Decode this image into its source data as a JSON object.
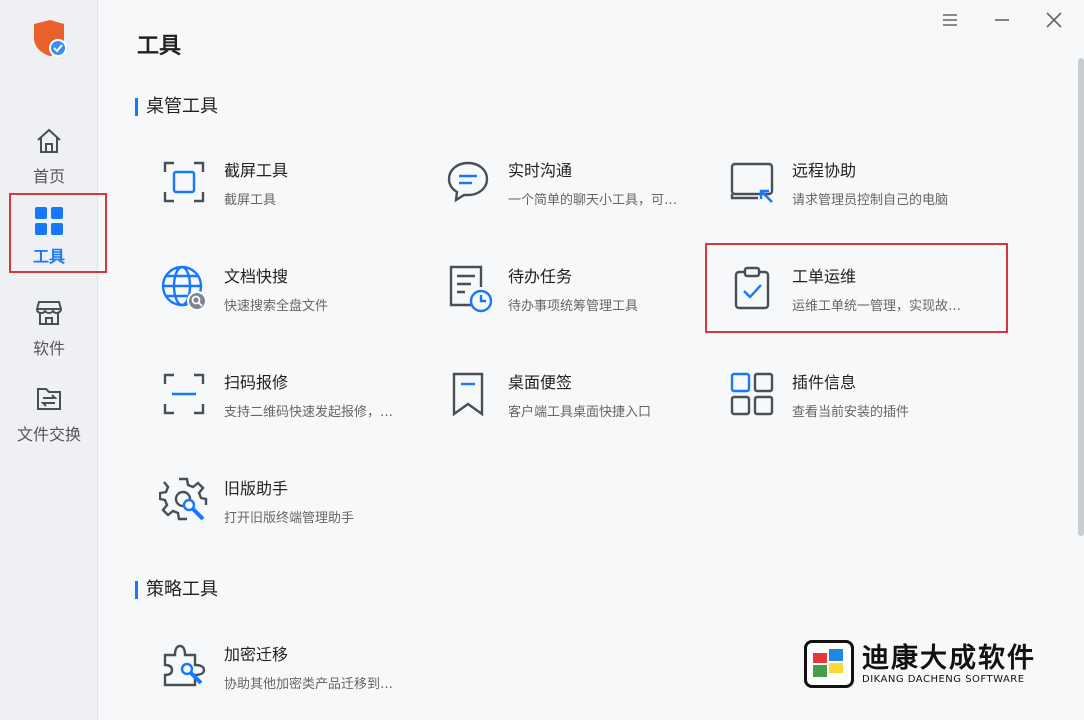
{
  "app": {
    "page_title": "工具"
  },
  "sidebar": {
    "items": [
      {
        "label": "首页",
        "icon": "home-icon"
      },
      {
        "label": "工具",
        "icon": "grid-icon",
        "active": true
      },
      {
        "label": "软件",
        "icon": "store-icon"
      },
      {
        "label": "文件交换",
        "icon": "file-exchange-icon"
      }
    ]
  },
  "sections": {
    "desktop": {
      "title": "桌管工具",
      "tools": [
        {
          "name": "截屏工具",
          "desc": "截屏工具",
          "icon": "screenshot-icon"
        },
        {
          "name": "实时沟通",
          "desc": "一个简单的聊天小工具，可…",
          "icon": "chat-icon"
        },
        {
          "name": "远程协助",
          "desc": "请求管理员控制自己的电脑",
          "icon": "remote-assist-icon"
        },
        {
          "name": "文档快搜",
          "desc": "快速搜索全盘文件",
          "icon": "globe-search-icon"
        },
        {
          "name": "待办任务",
          "desc": "待办事项统筹管理工具",
          "icon": "todo-clock-icon"
        },
        {
          "name": "工单运维",
          "desc": "运维工单统一管理，实现故…",
          "icon": "clipboard-check-icon"
        },
        {
          "name": "扫码报修",
          "desc": "支持二维码快速发起报修，…",
          "icon": "scan-icon"
        },
        {
          "name": "桌面便签",
          "desc": "客户端工具桌面快捷入口",
          "icon": "bookmark-icon"
        },
        {
          "name": "插件信息",
          "desc": "查看当前安装的插件",
          "icon": "plugin-grid-icon"
        },
        {
          "name": "旧版助手",
          "desc": "打开旧版终端管理助手",
          "icon": "gear-wrench-icon"
        }
      ]
    },
    "policy": {
      "title": "策略工具",
      "tools": [
        {
          "name": "加密迁移",
          "desc": "协助其他加密类产品迁移到…",
          "icon": "puzzle-wrench-icon"
        }
      ]
    }
  },
  "watermark": {
    "cn": "迪康大成软件",
    "en": "DIKANG DACHENG SOFTWARE"
  },
  "colors": {
    "accent": "#1677ff",
    "highlight": "#d9363e",
    "icon_stroke": "#4a4f57"
  }
}
